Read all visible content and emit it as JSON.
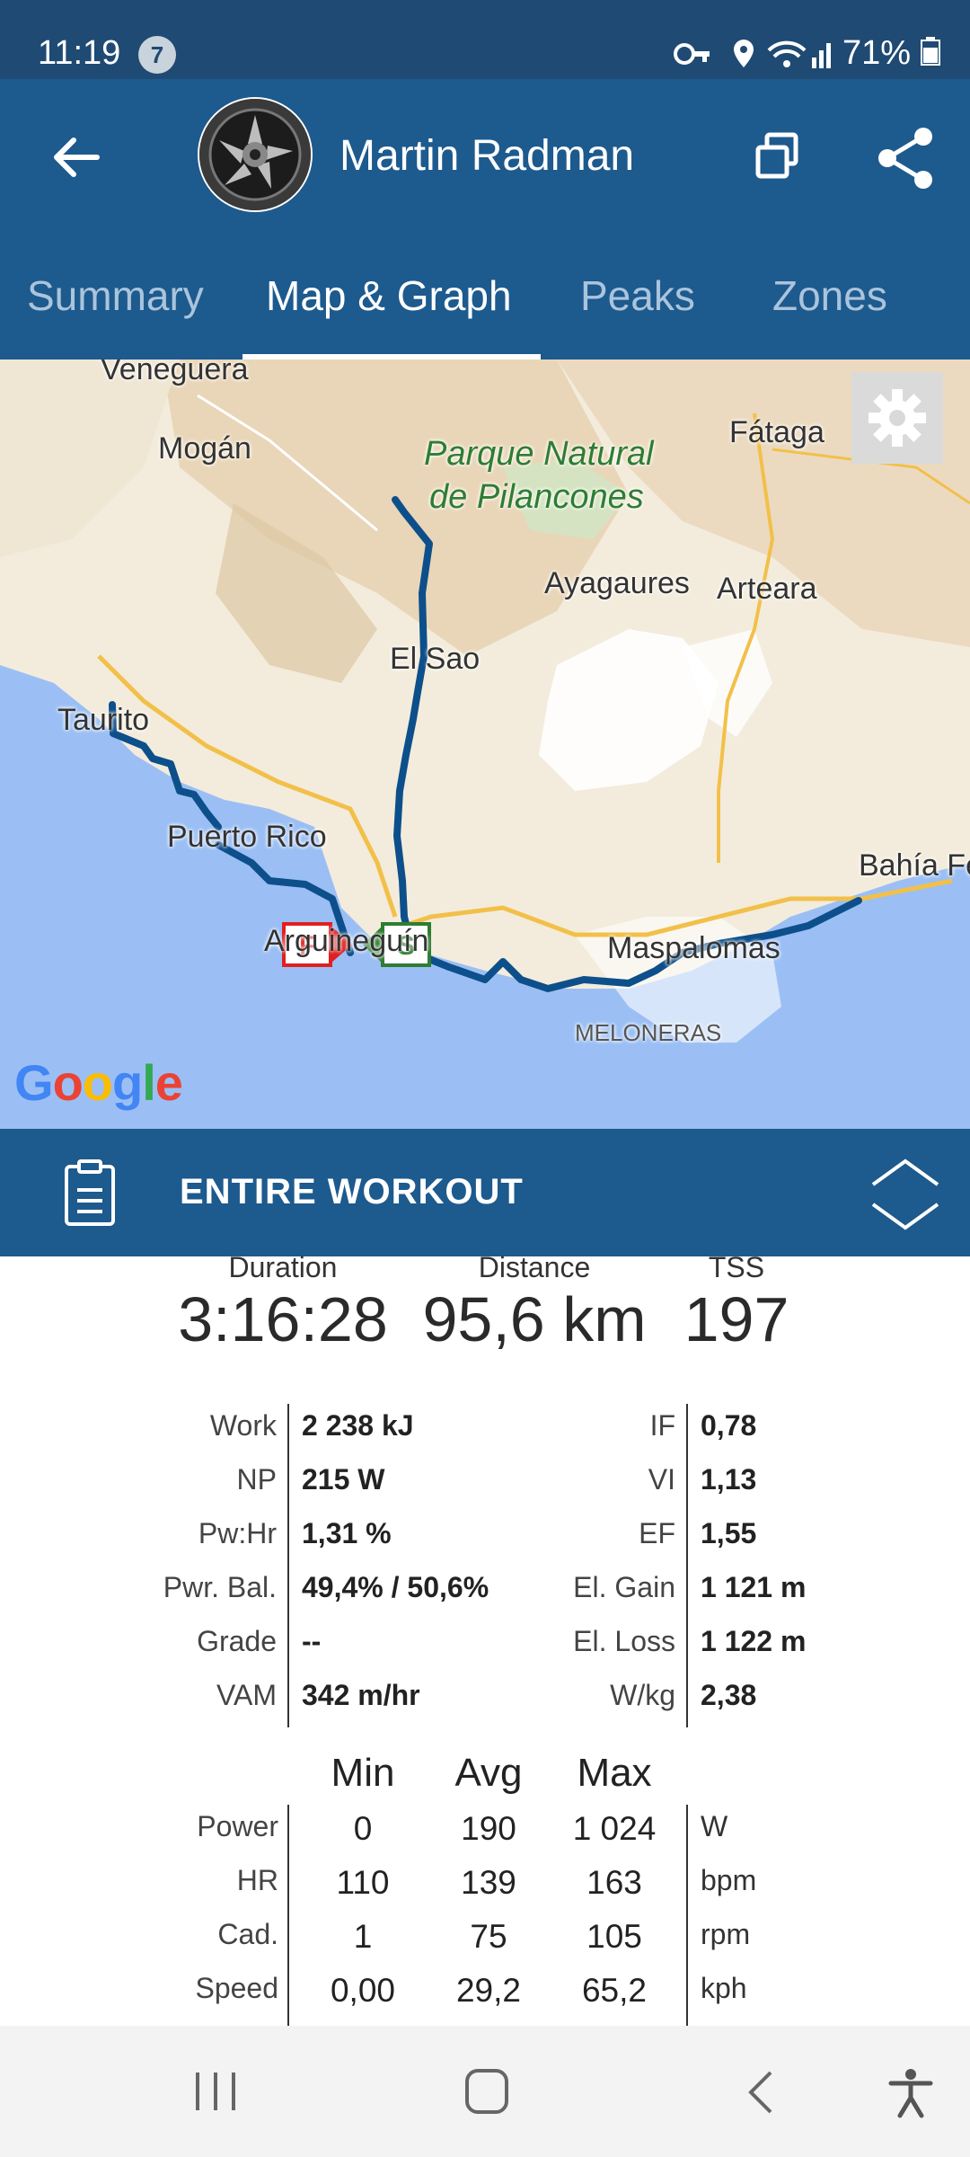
{
  "status_bar": {
    "time": "11:19",
    "notification_count": "7",
    "battery": "71%"
  },
  "header": {
    "title": "Martin Radman"
  },
  "tabs": [
    {
      "label": "Summary",
      "active": false
    },
    {
      "label": "Map & Graph",
      "active": true
    },
    {
      "label": "Peaks",
      "active": false
    },
    {
      "label": "Zones",
      "active": false
    }
  ],
  "map": {
    "labels": {
      "veneguera": "Veneguera",
      "mogan": "Mogán",
      "parque_line1": "Parque Natural",
      "parque_line2": "de Pilancones",
      "fataga": "Fátaga",
      "ayagaures": "Ayagaures",
      "arteara": "Arteara",
      "el_sao": "El Sao",
      "taurito": "Taurito",
      "puerto_rico": "Puerto Rico",
      "arguineguin": "Arguineguín",
      "maspalomas": "Maspalomas",
      "bahia": "Bahía Feliz",
      "meloneras": "MELONERAS"
    },
    "finish_marker": "F",
    "start_marker": "S",
    "attribution": "Google"
  },
  "workout_section": {
    "title": "ENTIRE WORKOUT"
  },
  "summary": [
    {
      "label": "Duration",
      "value": "3:16:28"
    },
    {
      "label": "Distance",
      "value": "95,6 km"
    },
    {
      "label": "TSS",
      "value": "197"
    }
  ],
  "metrics_left": [
    {
      "label": "Work",
      "value": "2 238 kJ"
    },
    {
      "label": "NP",
      "value": "215 W"
    },
    {
      "label": "Pw:Hr",
      "value": "1,31 %"
    },
    {
      "label": "Pwr. Bal.",
      "value": "49,4% / 50,6%"
    },
    {
      "label": "Grade",
      "value": "--"
    },
    {
      "label": "VAM",
      "value": "342 m/hr"
    }
  ],
  "metrics_right": [
    {
      "label": "IF",
      "value": "0,78"
    },
    {
      "label": "VI",
      "value": "1,13"
    },
    {
      "label": "EF",
      "value": "1,55"
    },
    {
      "label": "El. Gain",
      "value": "1 121 m"
    },
    {
      "label": "El. Loss",
      "value": "1 122 m"
    },
    {
      "label": "W/kg",
      "value": "2,38"
    }
  ],
  "minmax": {
    "headers": [
      "Min",
      "Avg",
      "Max"
    ],
    "rows": [
      {
        "label": "Power",
        "min": "0",
        "avg": "190",
        "max": "1 024",
        "unit": "W"
      },
      {
        "label": "HR",
        "min": "110",
        "avg": "139",
        "max": "163",
        "unit": "bpm"
      },
      {
        "label": "Cad.",
        "min": "1",
        "avg": "75",
        "max": "105",
        "unit": "rpm"
      },
      {
        "label": "Speed",
        "min": "0,00",
        "avg": "29,2",
        "max": "65,2",
        "unit": "kph"
      }
    ]
  },
  "colors": {
    "header_blue": "#1d5a8e",
    "status_blue": "#1f4a73",
    "route_blue": "#0d4f8b",
    "finish_red": "#e02020",
    "start_green": "#2e7d32",
    "sea_blue": "#9bbff4"
  }
}
